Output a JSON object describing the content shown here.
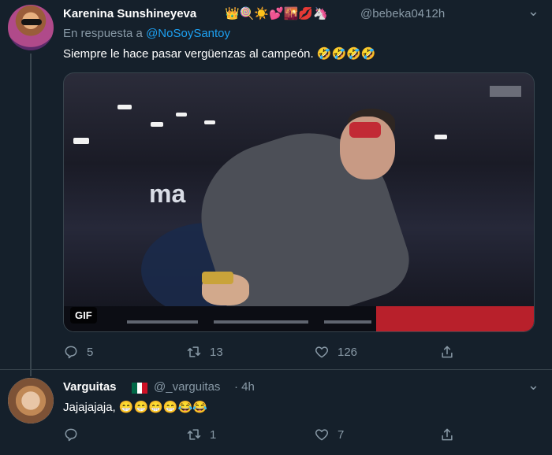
{
  "tweets": [
    {
      "display_name": "Karenina Sunshineyeva",
      "name_emojis": "👑🍭☀️💕🌇💋🦄",
      "handle": "@bebeka04",
      "time": "· 12h",
      "reply_prefix": "En respuesta a",
      "reply_mention": "@NoSoySantoy",
      "text": "Siempre le hace pasar vergüenzas al campeón. 🤣🤣🤣🤣",
      "media_badge": "GIF",
      "replies": "5",
      "retweets": "13",
      "likes": "126"
    },
    {
      "display_name": "Varguitas",
      "handle": "@_varguitas",
      "time": "· 4h",
      "text": "Jajajajaja, 😁😁😁😁😂😂",
      "replies": "",
      "retweets": "1",
      "likes": "7"
    }
  ],
  "icons": {
    "reply": "speech-bubble-icon",
    "retweet": "retweet-icon",
    "like": "heart-icon",
    "share": "share-icon",
    "more": "more-dots-icon",
    "flag": "mexico-flag-icon"
  },
  "colors": {
    "background": "#15202b",
    "primary_text": "#ffffff",
    "secondary_text": "#8899a6",
    "link": "#1da1f2",
    "divider": "#38444d"
  }
}
